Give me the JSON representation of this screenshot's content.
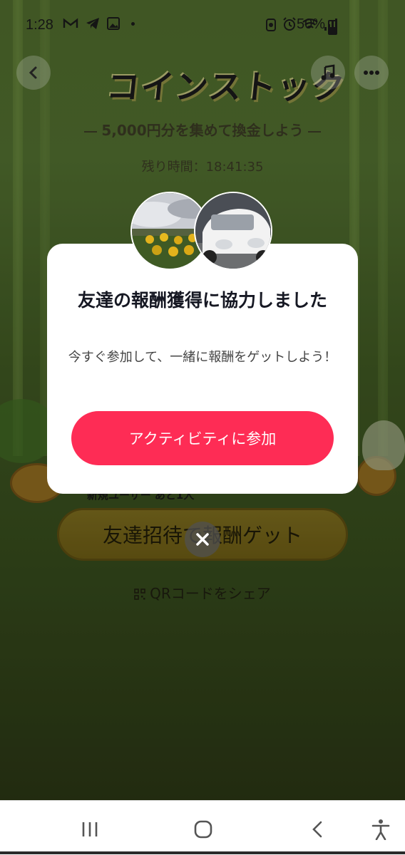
{
  "status_bar": {
    "time": "1:28",
    "battery": "50%"
  },
  "header": {
    "title": "コインストック",
    "subtitle": "5,000円分を集めて換金しよう",
    "remaining_time": "残り時間：18:41:35"
  },
  "background_page": {
    "new_user_text": "新規ユーザー あと1人",
    "invite_button_label": "友達招待で報酬ゲット",
    "qr_share_label": "QRコードをシェア"
  },
  "modal": {
    "title": "友達の報酬獲得に協力しました",
    "description": "今すぐ参加して、一緒に報酬をゲットしよう！",
    "join_button_label": "アクティビティに参加"
  },
  "icons": {
    "close": "close-icon",
    "back": "back-icon",
    "music": "music-icon",
    "more": "more-icon"
  },
  "colors": {
    "accent": "#fe2c55"
  }
}
